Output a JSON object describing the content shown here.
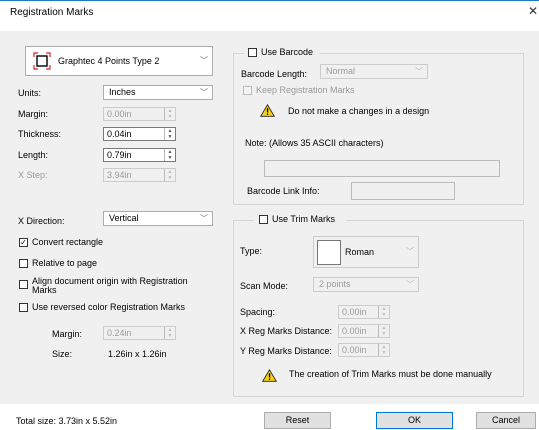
{
  "window": {
    "title": "Registration Marks",
    "close_glyph": "✕"
  },
  "left": {
    "mark_type": "Graphtec 4 Points Type 2",
    "units": {
      "label": "Units:",
      "value": "Inches"
    },
    "margin": {
      "label": "Margin:",
      "value": "0.00in"
    },
    "thickness": {
      "label": "Thickness:",
      "value": "0.04in"
    },
    "length": {
      "label": "Length:",
      "value": "0.79in"
    },
    "xstep": {
      "label": "X Step:",
      "value": "3.94in"
    },
    "xdirection": {
      "label": "X Direction:",
      "value": "Vertical"
    },
    "convert_rect": {
      "label": "Convert rectangle",
      "checked": true
    },
    "relative_page": {
      "label": "Relative to page",
      "checked": false
    },
    "align_origin": {
      "label_line1": "Align document origin with Registration",
      "label_line2": "Marks",
      "checked": false
    },
    "reversed_color": {
      "label": "Use reversed color Registration Marks",
      "checked": false
    },
    "rev_margin": {
      "label": "Margin:",
      "value": "0.24in"
    },
    "rev_size": {
      "label": "Size:",
      "value": "1.26in x 1.26in"
    }
  },
  "barcode": {
    "title": "Use Barcode",
    "length_label": "Barcode Length:",
    "length_value": "Normal",
    "keep_label": "Keep Registration Marks",
    "warning": "Do not make a changes in a design",
    "note": "Note: (Allows 35 ASCII characters)",
    "link_label": "Barcode Link Info:"
  },
  "trim": {
    "title": "Use Trim Marks",
    "type_label": "Type:",
    "type_value": "Roman",
    "scan_label": "Scan Mode:",
    "scan_value": "2 points",
    "spacing": {
      "label": "Spacing:",
      "value": "0.00in"
    },
    "xdist": {
      "label": "X Reg Marks Distance:",
      "value": "0.00in"
    },
    "ydist": {
      "label": "Y Reg Marks Distance:",
      "value": "0.00in"
    },
    "warning": "The creation of Trim Marks must be done manually"
  },
  "footer": {
    "total_size": "Total size:  3.73in x 5.52in",
    "reset": "Reset",
    "ok": "OK",
    "cancel": "Cancel"
  },
  "colors": {
    "accent": "#0078d7",
    "mark_red": "#d22b2b",
    "warning_yellow": "#f7d117"
  },
  "icons": [
    "registration-mark-icon",
    "warning-icon",
    "checkbox-check-icon",
    "close-icon",
    "dropdown-chevron-icon",
    "spin-arrows-icon"
  ]
}
